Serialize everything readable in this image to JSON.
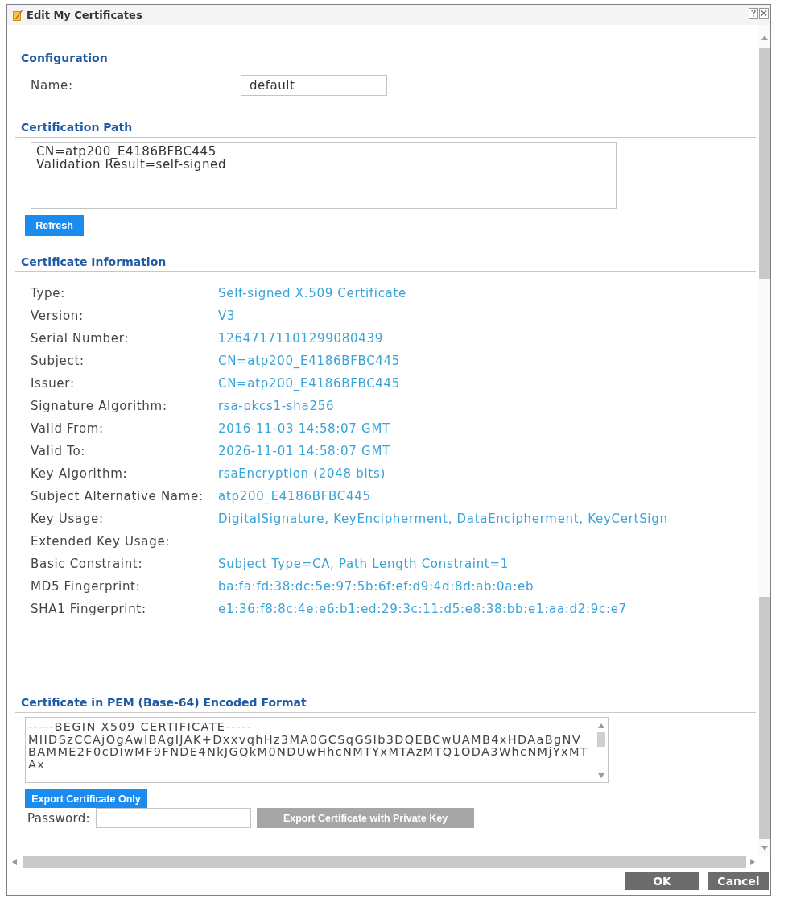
{
  "window": {
    "title": "Edit My Certificates"
  },
  "configuration": {
    "heading": "Configuration",
    "name": {
      "label": "Name:",
      "value": "default"
    }
  },
  "certification_path": {
    "heading": "Certification Path",
    "text_lines": [
      "CN=atp200_E4186BFBC445",
      "Validation Result=self-signed"
    ],
    "refresh_button": "Refresh"
  },
  "certificate_information": {
    "heading": "Certificate Information",
    "rows": [
      {
        "label": "Type:",
        "value": "Self-signed X.509 Certificate"
      },
      {
        "label": "Version:",
        "value": "V3"
      },
      {
        "label": "Serial Number:",
        "value": "12647171101299080439"
      },
      {
        "label": "Subject:",
        "value": "CN=atp200_E4186BFBC445"
      },
      {
        "label": "Issuer:",
        "value": "CN=atp200_E4186BFBC445"
      },
      {
        "label": "Signature Algorithm:",
        "value": "rsa-pkcs1-sha256"
      },
      {
        "label": "Valid From:",
        "value": "2016-11-03 14:58:07 GMT"
      },
      {
        "label": "Valid To:",
        "value": "2026-11-01 14:58:07 GMT"
      },
      {
        "label": "Key Algorithm:",
        "value": "rsaEncryption (2048 bits)"
      },
      {
        "label": "Subject Alternative Name:",
        "value": "atp200_E4186BFBC445"
      },
      {
        "label": "Key Usage:",
        "value": "DigitalSignature, KeyEncipherment, DataEncipherment, KeyCertSign"
      },
      {
        "label": "Extended Key Usage:"
      },
      {
        "label": "Basic Constraint:",
        "value": "Subject Type=CA, Path Length Constraint=1"
      },
      {
        "label": "MD5 Fingerprint:",
        "value": "ba:fa:fd:38:dc:5e:97:5b:6f:ef:d9:4d:8d:ab:0a:eb"
      },
      {
        "label": "SHA1 Fingerprint:",
        "value": "e1:36:f8:8c:4e:e6:b1:ed:29:3c:11:d5:e8:38:bb:e1:aa:d2:9c:e7"
      }
    ]
  },
  "pem_format": {
    "heading": "Certificate in PEM (Base-64) Encoded Format",
    "text_lines": [
      "-----BEGIN X509 CERTIFICATE-----",
      "MIIDSzCCAjOgAwIBAgIJAK+DxxvqhHz3MA0GCSqGSIb3DQEBCwUAMB4xHDAaBgNV",
      "BAMME2F0cDIwMF9FNDE4NkJGQkM0NDUwHhcNMTYxMTAzMTQ1ODA3WhcNMjYxMT",
      "Ax"
    ],
    "export_button": "Export Certificate Only",
    "password": {
      "label": "Password:"
    },
    "export_with_key_button": {
      "label": "Export Certificate with Private Key",
      "disabled": true
    }
  },
  "buttons": [
    "OK",
    "Cancel"
  ]
}
